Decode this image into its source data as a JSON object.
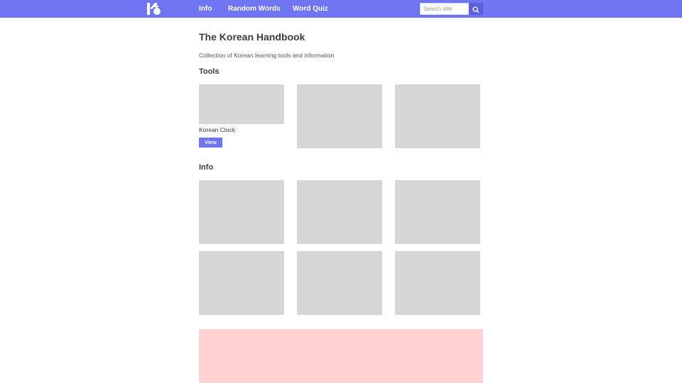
{
  "nav": {
    "links": [
      "Info",
      "Random Words",
      "Word Quiz"
    ],
    "search_placeholder": "Search site",
    "search_icon": "search-icon",
    "logo_icon": "korean-handbook-logo"
  },
  "main": {
    "title": "The Korean Handbook",
    "subtitle": "Collection of Korean learning tools and information"
  },
  "tools": {
    "heading": "Tools",
    "cards": [
      {
        "label": "Korean Clock",
        "button": "View"
      }
    ]
  },
  "info": {
    "heading": "Info"
  },
  "colors": {
    "accent": "#6f74f0",
    "placeholder_card": "#d6d6d6",
    "banner": "#ffd0d0"
  }
}
